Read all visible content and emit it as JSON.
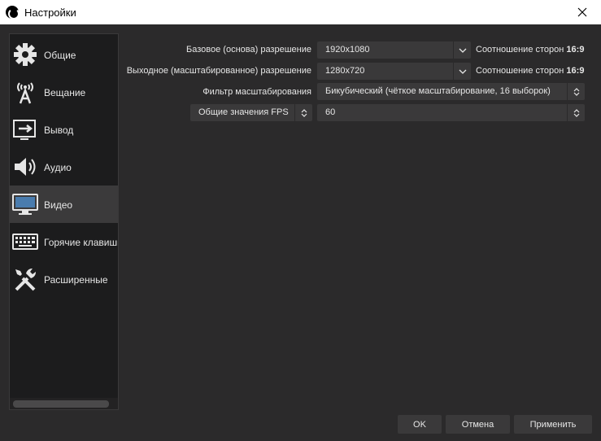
{
  "window": {
    "title": "Настройки"
  },
  "sidebar": {
    "items": [
      {
        "label": "Общие",
        "icon": "gear-icon"
      },
      {
        "label": "Вещание",
        "icon": "broadcast-antenna-icon"
      },
      {
        "label": "Вывод",
        "icon": "output-arrow-icon"
      },
      {
        "label": "Аудио",
        "icon": "speaker-icon"
      },
      {
        "label": "Видео",
        "icon": "monitor-icon",
        "selected": true
      },
      {
        "label": "Горячие клавиши",
        "icon": "keyboard-icon"
      },
      {
        "label": "Расширенные",
        "icon": "tools-icon"
      }
    ]
  },
  "video": {
    "base_resolution": {
      "label": "Базовое (основа) разрешение",
      "value": "1920x1080",
      "aspect_label": "Соотношение сторон",
      "aspect_value": "16:9"
    },
    "output_resolution": {
      "label": "Выходное (масштабированное) разрешение",
      "value": "1280x720",
      "aspect_label": "Соотношение сторон",
      "aspect_value": "16:9"
    },
    "scale_filter": {
      "label": "Фильтр масштабирования",
      "value": "Бикубический (чёткое масштабирование, 16 выборок)"
    },
    "fps": {
      "type_value": "Общие значения FPS",
      "value": "60"
    }
  },
  "buttons": {
    "ok": "OK",
    "cancel": "Отмена",
    "apply": "Применить"
  }
}
